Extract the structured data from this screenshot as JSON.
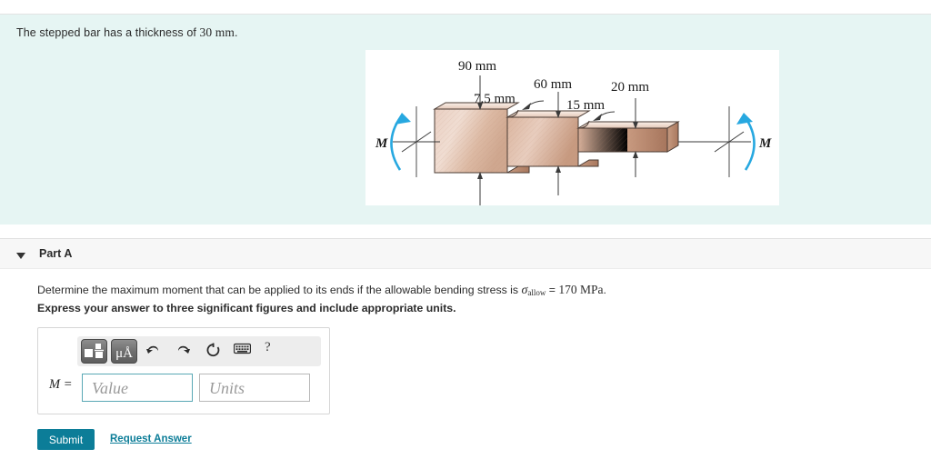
{
  "problem": {
    "statement_prefix": "The stepped bar has a thickness of ",
    "thickness_value": "30 mm",
    "statement_suffix": "."
  },
  "figure": {
    "caption_labels": {
      "left_moment": "M",
      "right_moment": "M",
      "dim_90": "90 mm",
      "dim_7_5": "7.5 mm",
      "dim_60": "60 mm",
      "dim_15": "15 mm",
      "dim_20": "20 mm"
    },
    "colors": {
      "moment_arrow": "#27a8e0",
      "body_light": "#f2ddd2",
      "body_mid": "#d9ab92",
      "body_dark": "#b07f64",
      "outline": "#4a3b33"
    }
  },
  "part_a": {
    "toggle_icon": "chevron-down-icon",
    "title": "Part A",
    "question_prefix": "Determine the maximum moment that can be applied to its ends if the allowable bending stress is ",
    "sigma_symbol": "σ",
    "sigma_subscript": "allow",
    "question_equals": " = ",
    "stress_value": "170 MPa",
    "question_suffix": ".",
    "instruction": "Express your answer to three significant figures and include appropriate units."
  },
  "answer": {
    "toolbar": {
      "template_button": "template-icon",
      "units_button": "μÅ",
      "undo_button": "undo-icon",
      "redo_button": "redo-icon",
      "reset_button": "reset-icon",
      "keyboard_button": "keyboard-icon",
      "help_button": "?"
    },
    "variable_label": "M =",
    "value_placeholder": "Value",
    "units_placeholder": "Units",
    "value_current": "",
    "units_current": ""
  },
  "actions": {
    "submit_label": "Submit",
    "request_answer_label": "Request Answer",
    "accent_color": "#0c7d98"
  }
}
